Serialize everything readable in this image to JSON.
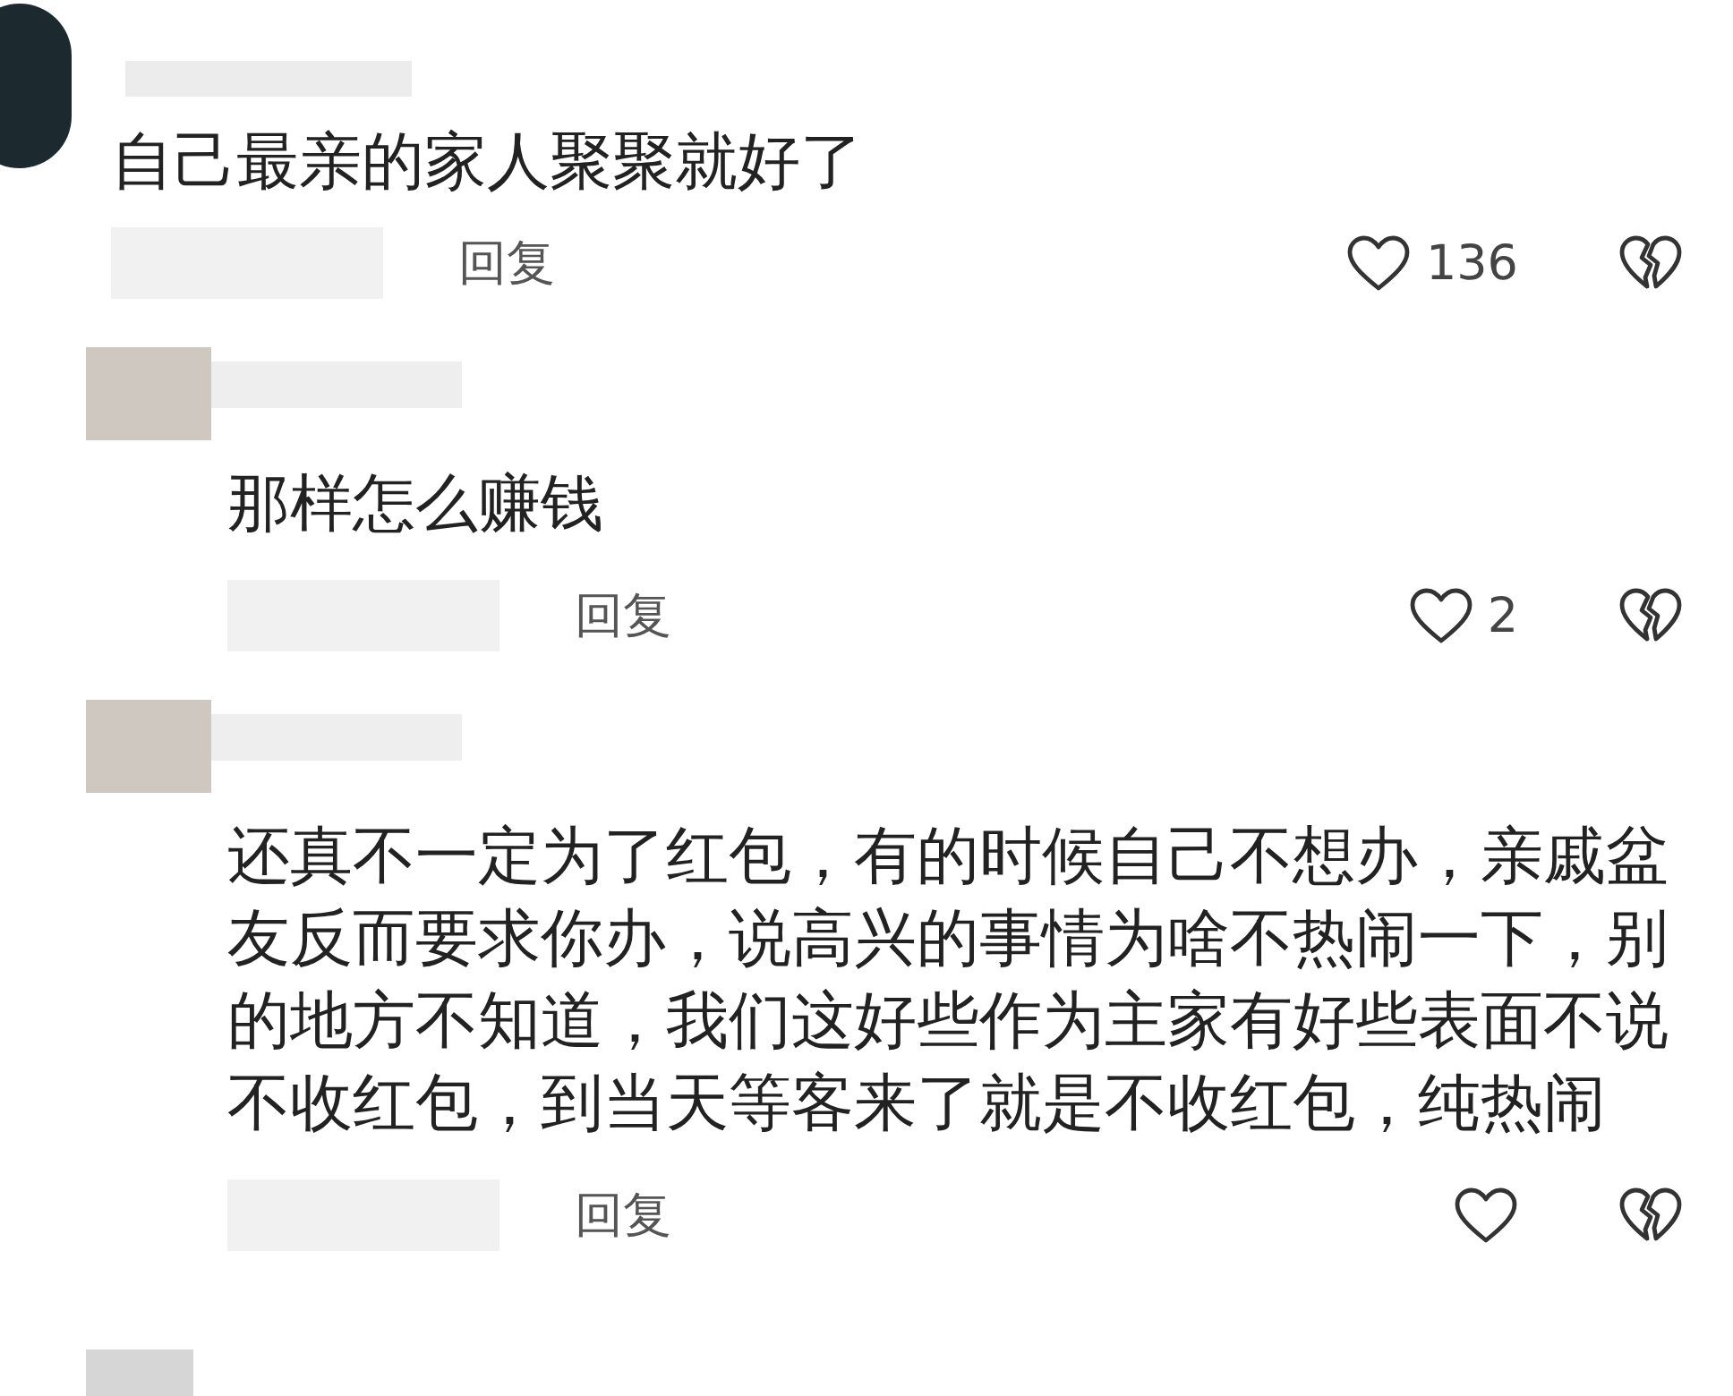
{
  "comments": [
    {
      "text": "自己最亲的家人聚聚就好了",
      "reply_label": "回复",
      "likes": "136",
      "children": [
        {
          "text": "那样怎么赚钱",
          "reply_label": "回复",
          "likes": "2"
        },
        {
          "text": "还真不一定为了红包，有的时候自己不想办，亲戚盆友反而要求你办，说高兴的事情为啥不热闹一下，别的地方不知道，我们这好些作为主家有好些表面不说不收红包，到当天等客来了就是不收红包，纯热闹",
          "reply_label": "回复"
        }
      ]
    }
  ]
}
